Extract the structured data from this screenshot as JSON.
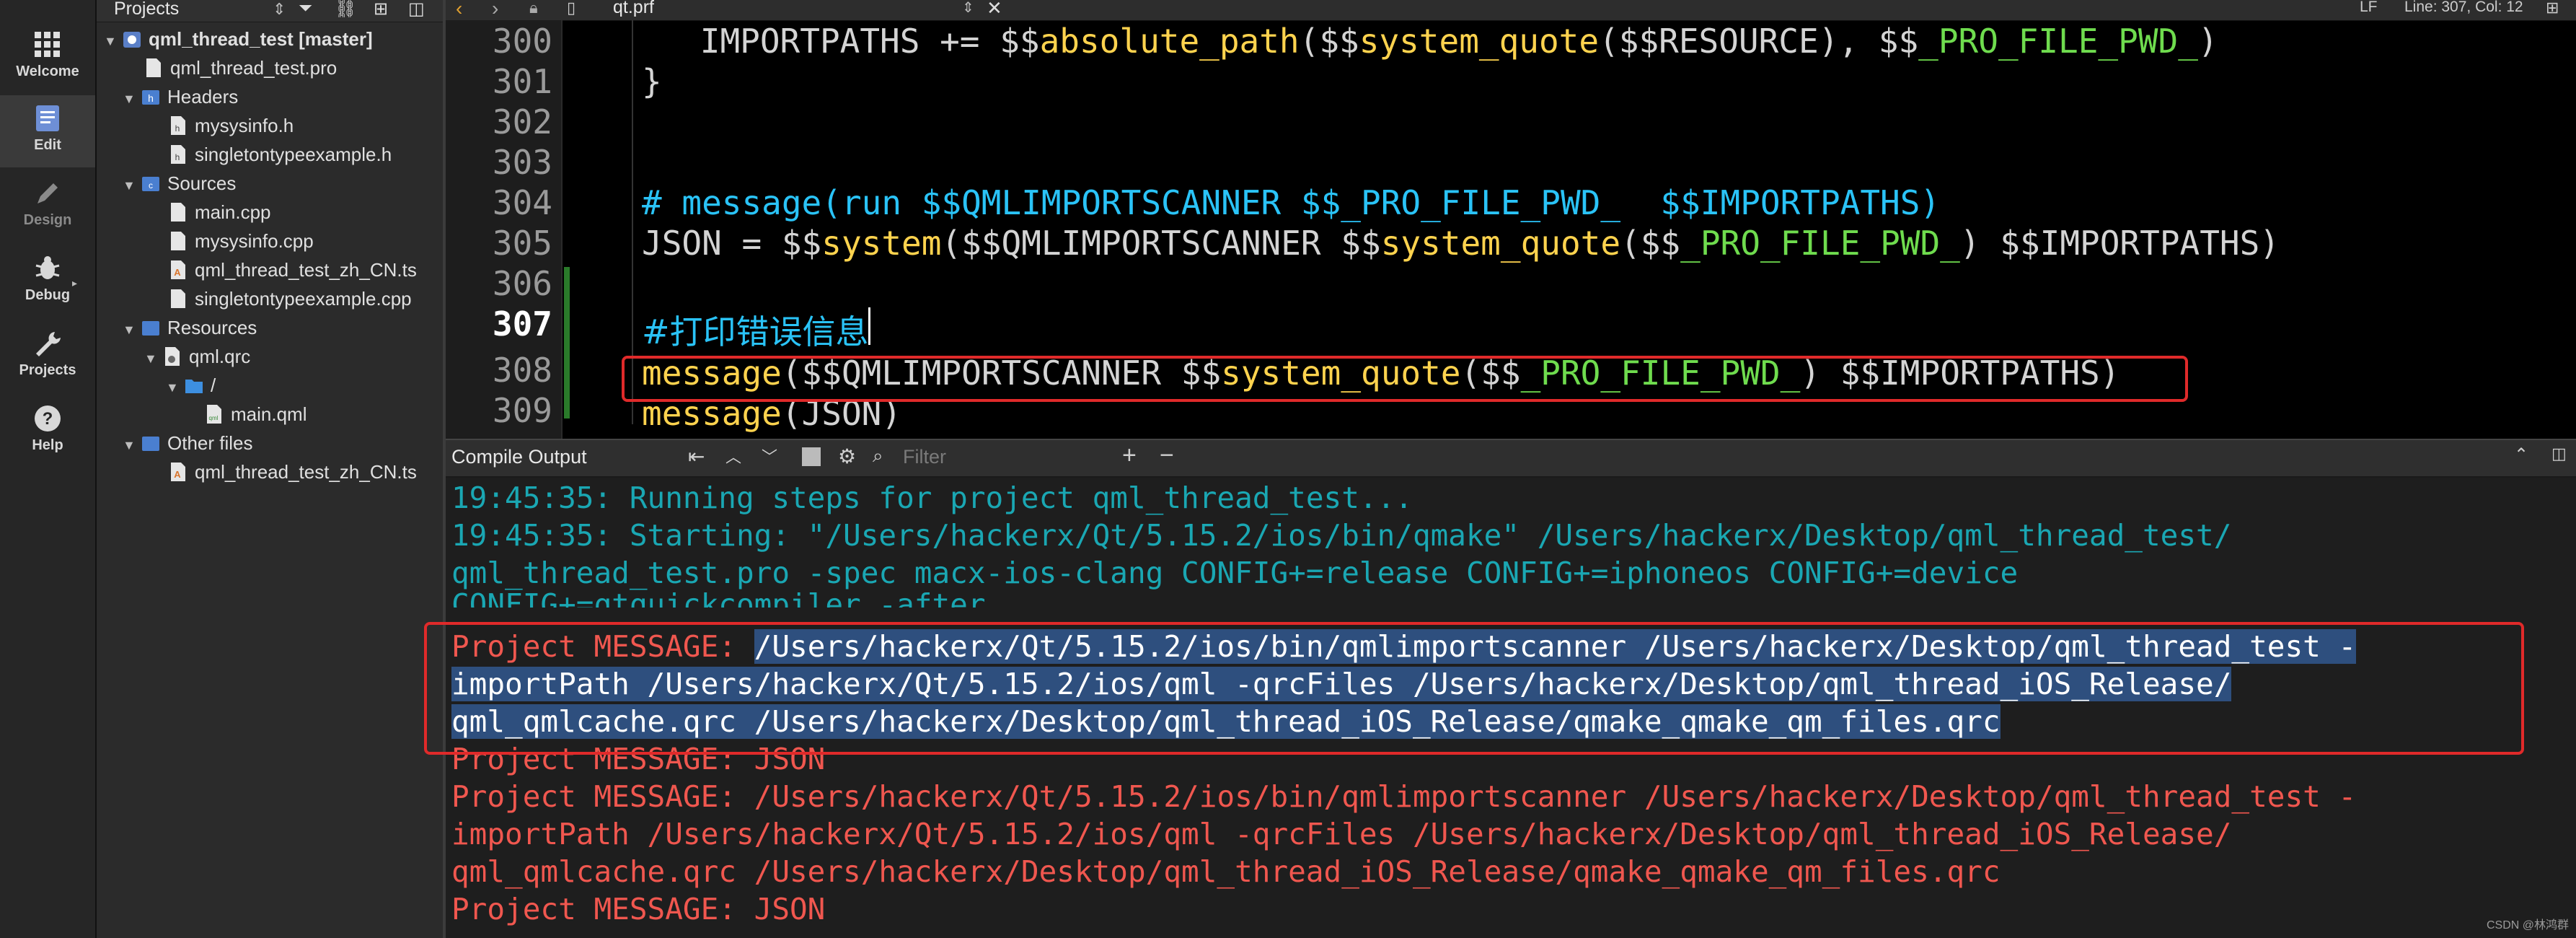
{
  "modes": [
    {
      "label": "Welcome",
      "icon": "grid-icon"
    },
    {
      "label": "Edit",
      "icon": "edit-document-icon"
    },
    {
      "label": "Design",
      "icon": "pencil-icon"
    },
    {
      "label": "Debug",
      "icon": "bug-icon"
    },
    {
      "label": "Projects",
      "icon": "wrench-icon"
    },
    {
      "label": "Help",
      "icon": "help-icon"
    }
  ],
  "tree": {
    "header": "Projects",
    "items": [
      {
        "label": "qml_thread_test [master]"
      },
      {
        "label": "qml_thread_test.pro"
      },
      {
        "label": "Headers"
      },
      {
        "label": "mysysinfo.h"
      },
      {
        "label": "singletontypeexample.h"
      },
      {
        "label": "Sources"
      },
      {
        "label": "main.cpp"
      },
      {
        "label": "mysysinfo.cpp"
      },
      {
        "label": "qml_thread_test_zh_CN.ts"
      },
      {
        "label": "singletontypeexample.cpp"
      },
      {
        "label": "Resources"
      },
      {
        "label": "qml.qrc"
      },
      {
        "label": "/"
      },
      {
        "label": "main.qml"
      },
      {
        "label": "Other files"
      },
      {
        "label": "qml_thread_test_zh_CN.ts"
      }
    ]
  },
  "editor": {
    "file": "qt.prf",
    "line_ending": "LF",
    "cursor": "Line: 307, Col: 12",
    "line_numbers": [
      "300",
      "301",
      "302",
      "303",
      "304",
      "305",
      "306",
      "307",
      "308",
      "309"
    ],
    "l300a": "    IMPORTPATHS += $$",
    "l300b": "absolute_path",
    "l300c": "($$",
    "l300d": "system_quote",
    "l300e": "($$RESOURCE), $$",
    "l300f": "_PRO_FILE_PWD_",
    "l300g": ")",
    "l301": "}",
    "l304": "# message(run $$QMLIMPORTSCANNER $$_PRO_FILE_PWD_  $$IMPORTPATHS)",
    "l305a": "JSON = $$",
    "l305b": "system",
    "l305c": "($$QMLIMPORTSCANNER $$",
    "l305d": "system_quote",
    "l305e": "($$",
    "l305f": "_PRO_FILE_PWD_",
    "l305g": ") $$IMPORTPATHS)",
    "l307": "#打印错误信息",
    "l308a": "message",
    "l308b": "($$QMLIMPORTSCANNER $$",
    "l308c": "system_quote",
    "l308d": "($$",
    "l308e": "_PRO_FILE_PWD_",
    "l308f": ") $$IMPORTPATHS)",
    "l309a": "message",
    "l309b": "(JSON)"
  },
  "output": {
    "title": "Compile Output",
    "filter_placeholder": "Filter",
    "lines": [
      "19:45:35: Running steps for project qml_thread_test...",
      "19:45:35: Starting: \"/Users/hackerx/Qt/5.15.2/ios/bin/qmake\" /Users/hackerx/Desktop/qml_thread_test/",
      "qml_thread_test.pro -spec macx-ios-clang CONFIG+=release CONFIG+=iphoneos CONFIG+=device",
      "CONFIG+=qtquickcompiler -after"
    ],
    "msg_prefix": "Project MESSAGE: ",
    "sel1": "/Users/hackerx/Qt/5.15.2/ios/bin/qmlimportscanner /Users/hackerx/Desktop/qml_thread_test -",
    "sel2": "importPath /Users/hackerx/Qt/5.15.2/ios/qml -qrcFiles /Users/hackerx/Desktop/qml_thread_iOS_Release/",
    "sel3": "qml_qmlcache.qrc /Users/hackerx/Desktop/qml_thread_iOS_Release/qmake_qmake_qm_files.qrc",
    "msg_json": "Project MESSAGE: JSON",
    "r1": "Project MESSAGE: /Users/hackerx/Qt/5.15.2/ios/bin/qmlimportscanner /Users/hackerx/Desktop/qml_thread_test -",
    "r2": "importPath /Users/hackerx/Qt/5.15.2/ios/qml -qrcFiles /Users/hackerx/Desktop/qml_thread_iOS_Release/",
    "r3": "qml_qmlcache.qrc /Users/hackerx/Desktop/qml_thread_iOS_Release/qmake_qmake_qm_files.qrc",
    "r4": "Project MESSAGE: JSON"
  },
  "watermark": "CSDN @林鸿群"
}
